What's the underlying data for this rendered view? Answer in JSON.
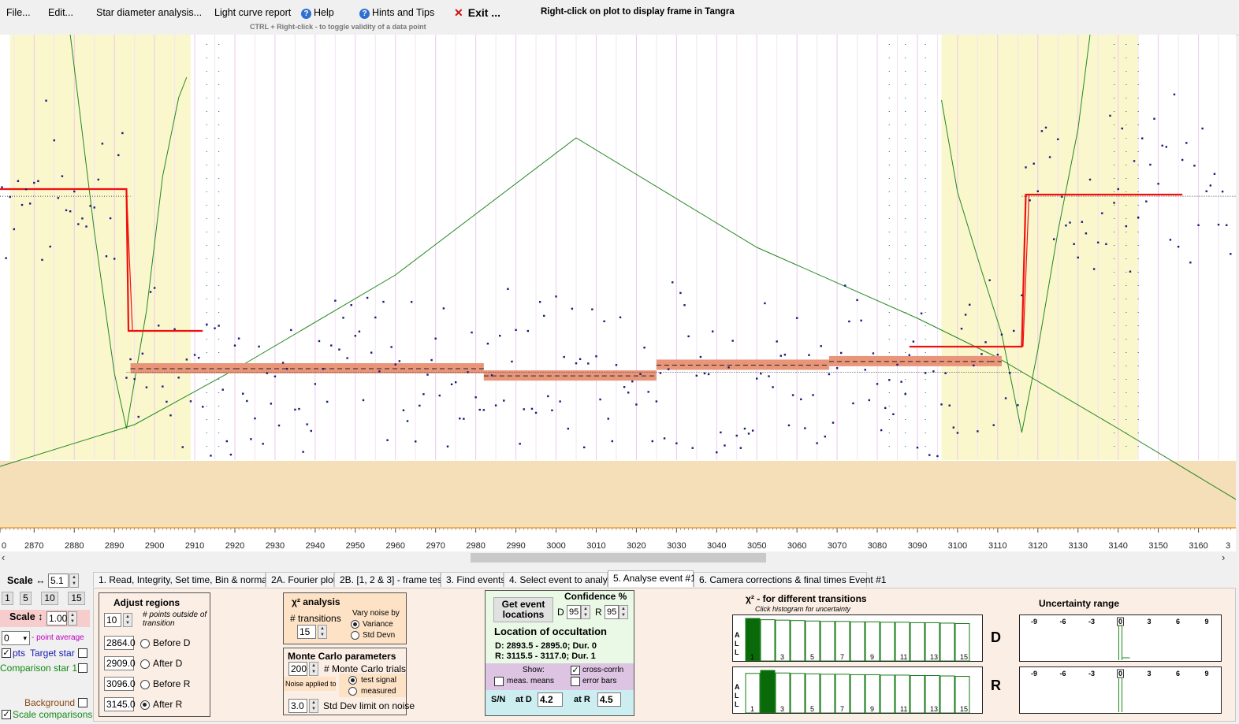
{
  "menu": {
    "file": "File...",
    "edit": "Edit...",
    "star_diameter": "Star diameter analysis...",
    "light_curve": "Light curve report",
    "help": "Help",
    "hints": "Hints and Tips",
    "exit": "Exit ...",
    "right_click_hint": "Right-click on plot to display frame in Tangra",
    "ctrl_hint": "CTRL + Right-click  -  to toggle validity of a data point"
  },
  "plot": {
    "x_ticks": [
      "0",
      "2870",
      "2880",
      "2890",
      "2900",
      "2910",
      "2920",
      "2930",
      "2940",
      "2950",
      "2960",
      "2970",
      "2980",
      "2990",
      "3000",
      "3010",
      "3020",
      "3030",
      "3040",
      "3050",
      "3060",
      "3070",
      "3080",
      "3090",
      "3100",
      "3110",
      "3120",
      "3130",
      "3140",
      "3150",
      "3160",
      "3"
    ],
    "colors": {
      "background": "#ffffff",
      "region": "#fbf7cd",
      "noise_band": "#f5dfb8",
      "model": "#ee1111",
      "means": "#e8957a",
      "points": "#1a1a7a",
      "chi2_curve": "#228822"
    }
  },
  "left_panel": {
    "scale_h_label": "Scale ↔",
    "scale_h_value": "5.1",
    "scale_buttons": [
      "1",
      "5",
      "10",
      "15"
    ],
    "scale_v_label": "Scale ↕",
    "scale_v_value": "1.00",
    "point_avg_value": "0",
    "point_avg_label": "- point average",
    "pts_label": "pts",
    "target_label": "Target star",
    "comparison_label": "Comparison star 1",
    "background_label": "Background",
    "scale_comparisons_label": "Scale comparisons"
  },
  "tabs": [
    "1.  Read, Integrity, Set time, Bin & normalise",
    "2A. Fourier plot",
    "2B. [1, 2 & 3] - frame test",
    "3. Find events",
    "4. Select event to analyse",
    "5. Analyse event #1",
    "6. Camera corrections & final times Event #1"
  ],
  "adjust": {
    "title": "Adjust regions",
    "points_value": "10",
    "points_label": "# points outside of transition",
    "rows": [
      {
        "value": "2864.0",
        "label": "Before D"
      },
      {
        "value": "2909.0",
        "label": "After D"
      },
      {
        "value": "3096.0",
        "label": "Before R"
      },
      {
        "value": "3145.0",
        "label": "After R"
      }
    ]
  },
  "chi2": {
    "title": "χ² analysis",
    "transitions_label": "# transitions",
    "transitions_value": "15",
    "vary_label": "Vary noise by",
    "variance": "Variance",
    "stddevn": "Std Devn"
  },
  "montecarlo": {
    "title": "Monte Carlo parameters",
    "trials_value": "200",
    "trials_label": "# Monte Carlo trials",
    "noise_applied": "Noise applied to",
    "test_signal": "test signal",
    "measured": "measured",
    "limit_value": "3.0",
    "limit_label": "Std Dev limit on noise"
  },
  "location": {
    "get_event_button": "Get event locations",
    "confidence_title": "Confidence %",
    "d_label": "D",
    "d_value": "95",
    "r_label": "R",
    "r_value": "95",
    "title": "Location of occultation",
    "d_result": "D: 2893.5 - 2895.0; Dur. 0",
    "r_result": "R: 3115.5 - 3117.0; Dur. 1",
    "show_label": "Show:",
    "meas_means": "meas. means",
    "cross_corrln": "cross-corrln",
    "error_bars": "error bars",
    "sn_label": "S/N",
    "at_d_label": "at D",
    "at_d_value": "4.2",
    "at_r_label": "at R",
    "at_r_value": "4.5"
  },
  "chi2_hist": {
    "title": "χ² - for different transitions",
    "subtitle": "Click histogram for uncertainty",
    "side_label": "A L L",
    "x_labels": [
      "1",
      "3",
      "5",
      "7",
      "9",
      "11",
      "13",
      "15"
    ],
    "d_label": "D",
    "r_label": "R",
    "d_values": [
      1.0,
      0.97,
      0.96,
      0.95,
      0.94,
      0.93,
      0.93,
      0.92,
      0.92,
      0.91,
      0.91,
      0.9,
      0.9,
      0.89,
      0.88
    ],
    "r_values": [
      0.93,
      1.0,
      0.94,
      0.93,
      0.92,
      0.91,
      0.91,
      0.9,
      0.9,
      0.89,
      0.89,
      0.88,
      0.88,
      0.87,
      0.86
    ],
    "d_selected": 1,
    "r_selected": 2
  },
  "uncertainty": {
    "title": "Uncertainty range",
    "ticks": [
      "-9",
      "-6",
      "-3",
      "0",
      "3",
      "6",
      "9"
    ]
  }
}
